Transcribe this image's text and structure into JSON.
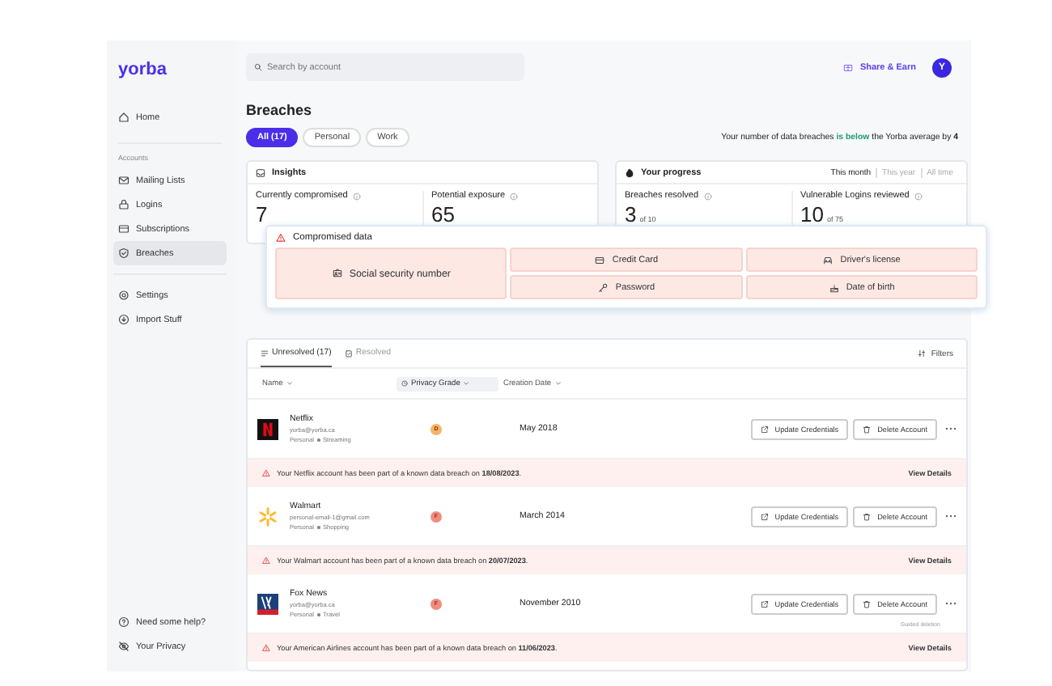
{
  "sidebar": {
    "logo": "yorba",
    "top_items": [
      {
        "label": "Home",
        "selected": false
      }
    ],
    "section_label": "Accounts",
    "account_items": [
      {
        "label": "Mailing Lists",
        "selected": false
      },
      {
        "label": "Logins",
        "selected": false
      },
      {
        "label": "Subscriptions",
        "selected": false
      },
      {
        "label": "Breaches",
        "selected": true
      }
    ],
    "more_items": [
      {
        "label": "Settings",
        "selected": false
      },
      {
        "label": "Import Stuff",
        "selected": false
      }
    ],
    "footer_items": [
      {
        "label": "Need some help?"
      },
      {
        "label": "Your Privacy"
      }
    ]
  },
  "header": {
    "search": {
      "placeholder": "Search by account"
    },
    "share": "Share & Earn",
    "avatar": "Y"
  },
  "page": {
    "title": "Breaches",
    "filters": [
      {
        "label": "All (17)",
        "selected": true
      },
      {
        "label": "Personal",
        "selected": false
      },
      {
        "label": "Work",
        "selected": false
      }
    ],
    "comparison": "Your number of data breaches **is below** the Yorba average by **4**"
  },
  "insights": {
    "title": "Insights",
    "metrics": [
      {
        "label": "Currently compromised",
        "value": "7"
      },
      {
        "label": "Potential exposure",
        "value": "65"
      }
    ]
  },
  "progress": {
    "title": "Your progress",
    "periods": [
      {
        "label": "This month",
        "selected": true
      },
      {
        "label": "This year",
        "selected": false
      },
      {
        "label": "All time",
        "selected": false
      }
    ],
    "metrics": [
      {
        "label": "Breaches resolved",
        "value": "3",
        "of": "of 10"
      },
      {
        "label": "Vulnerable Logins reviewed",
        "value": "10",
        "of": "of 75"
      }
    ]
  },
  "compromised_data": {
    "title": "Compromised data",
    "items": [
      {
        "label": "Social security number"
      },
      {
        "label": "Credit Card"
      },
      {
        "label": "Driver's license"
      },
      {
        "label": "Password"
      },
      {
        "label": "Date of birth"
      }
    ]
  },
  "table": {
    "tabs": [
      {
        "label": "Unresolved (17)",
        "selected": true
      },
      {
        "label": "Resolved",
        "selected": false
      }
    ],
    "filters": "Filters",
    "columns": [
      {
        "label": "Name",
        "selected": false
      },
      {
        "label": "Privacy Grade",
        "selected": true
      },
      {
        "label": "Creation Date",
        "selected": false
      }
    ],
    "rows": [
      {
        "kind": "netflix",
        "name": "Netflix",
        "email": "yorba@yorba.ca",
        "tags": [
          "Personal",
          "Streaming"
        ],
        "grade": "D",
        "color": "#f7b267",
        "date": "May 2018",
        "actions": [
          "Update Credentials",
          "Delete Account"
        ],
        "alert": "Your Netflix account has been part of a known data breach on **18/08/2023**.",
        "details": "View Details"
      },
      {
        "kind": "walmart",
        "name": "Walmart",
        "email": "personal-email-1@gmail.com",
        "tags": [
          "Personal",
          "Shopping"
        ],
        "grade": "F",
        "color": "#f28b82",
        "date": "March 2014",
        "actions": [
          "Update Credentials",
          "Delete Account"
        ],
        "alert": "Your Walmart account has been part of a known data breach on **20/07/2023**.",
        "details": "View Details"
      },
      {
        "kind": "foxnews",
        "name": "Fox News",
        "email": "yorba@yorba.ca",
        "tags": [
          "Personal",
          "Travel"
        ],
        "grade": "F",
        "color": "#f28b82",
        "date": "November 2010",
        "actions": [
          "Update Credentials",
          "Delete Account"
        ],
        "note": "Guided deletion",
        "alert": "Your American Airlines account has been part of a known data breach on **11/06/2023**.",
        "details": "View Details"
      }
    ]
  }
}
